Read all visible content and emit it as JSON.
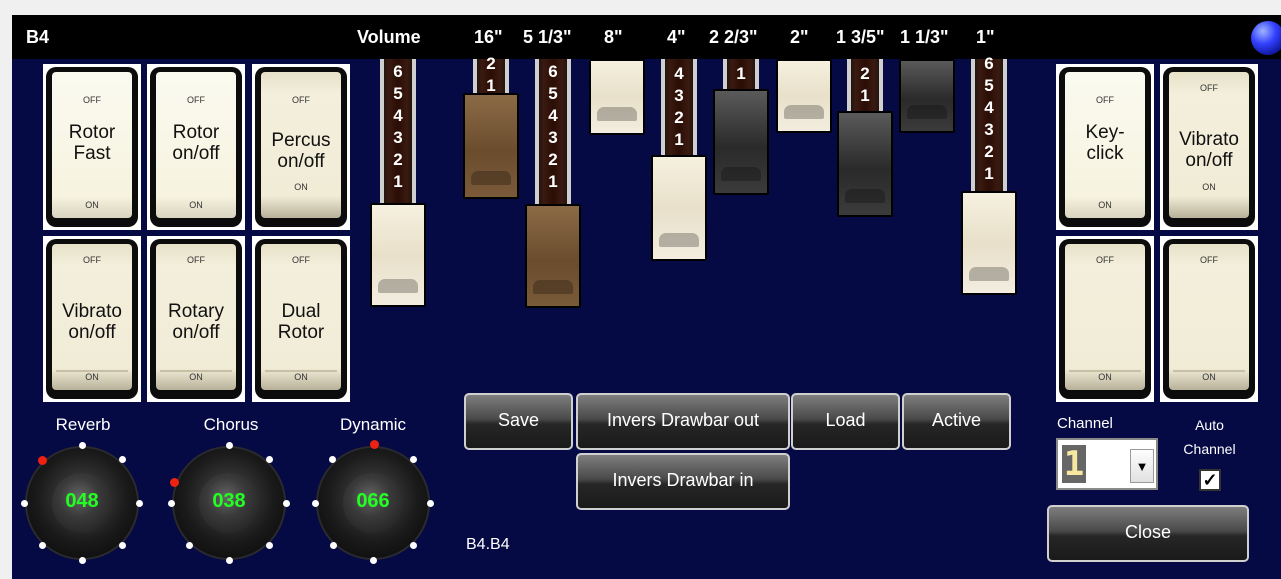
{
  "window": {
    "title": "B4",
    "volume_label": "Volume",
    "footages": [
      "16\"",
      "5 1/3\"",
      "8\"",
      "4\"",
      "2 2/3\"",
      "2\"",
      "1 3/5\"",
      "1 1/3\"",
      "1\""
    ]
  },
  "switches": {
    "rotor_fast": {
      "off": "OFF",
      "on": "ON",
      "line1": "Rotor",
      "line2": "Fast"
    },
    "rotor_onoff": {
      "off": "OFF",
      "on": "ON",
      "line1": "Rotor",
      "line2": "on/off"
    },
    "percus_onoff": {
      "off": "OFF",
      "on": "ON",
      "line1": "Percus",
      "line2": "on/off"
    },
    "vibrato_onoff_left": {
      "off": "OFF",
      "on": "ON",
      "line1": "Vibrato",
      "line2": "on/off"
    },
    "rotary_onoff": {
      "off": "OFF",
      "on": "ON",
      "line1": "Rotary",
      "line2": "on/off"
    },
    "dual_rotor": {
      "off": "OFF",
      "on": "ON",
      "line1": "Dual",
      "line2": "Rotor"
    },
    "keyclick": {
      "off": "OFF",
      "on": "ON",
      "line1": "Key-",
      "line2": "click"
    },
    "vibrato_onoff_right": {
      "off": "OFF",
      "on": "ON",
      "line1": "Vibrato",
      "line2": "on/off"
    },
    "blank_left": {
      "off": "OFF",
      "on": "ON"
    },
    "blank_right": {
      "off": "OFF",
      "on": "ON"
    }
  },
  "drawbars": {
    "volume": {
      "visible_numbers": [
        "6",
        "5",
        "4",
        "3",
        "2",
        "1"
      ],
      "color": "white"
    },
    "f16": {
      "visible_numbers": [
        "2",
        "1"
      ],
      "color": "brown"
    },
    "f5_1_3": {
      "visible_numbers": [
        "6",
        "5",
        "4",
        "3",
        "2",
        "1"
      ],
      "color": "brown"
    },
    "f8": {
      "visible_numbers": [],
      "color": "white"
    },
    "f4": {
      "visible_numbers": [
        "4",
        "3",
        "2",
        "1"
      ],
      "color": "white"
    },
    "f2_2_3": {
      "visible_numbers": [
        "1"
      ],
      "color": "black"
    },
    "f2": {
      "visible_numbers": [],
      "color": "white"
    },
    "f1_3_5": {
      "visible_numbers": [
        "2",
        "1"
      ],
      "color": "black"
    },
    "f1_1_3": {
      "visible_numbers": [],
      "color": "black"
    },
    "f1": {
      "visible_numbers": [
        "6",
        "5",
        "4",
        "3",
        "2",
        "1"
      ],
      "color": "white"
    }
  },
  "knobs": {
    "reverb": {
      "label": "Reverb",
      "value": "048"
    },
    "chorus": {
      "label": "Chorus",
      "value": "038"
    },
    "dynamic": {
      "label": "Dynamic",
      "value": "066"
    }
  },
  "buttons": {
    "save": "Save",
    "invers_out": "Invers Drawbar out",
    "load": "Load",
    "active": "Active",
    "invers_in": "Invers Drawbar in",
    "close": "Close"
  },
  "preset_name": "B4.B4",
  "channel": {
    "label": "Channel",
    "value": "1"
  },
  "auto_channel": {
    "line1": "Auto",
    "line2": "Channel",
    "checked": true,
    "mark": "✓"
  },
  "colors": {
    "panel": "#050a45",
    "titlebar": "#000000",
    "knob_value": "#22ff22"
  }
}
